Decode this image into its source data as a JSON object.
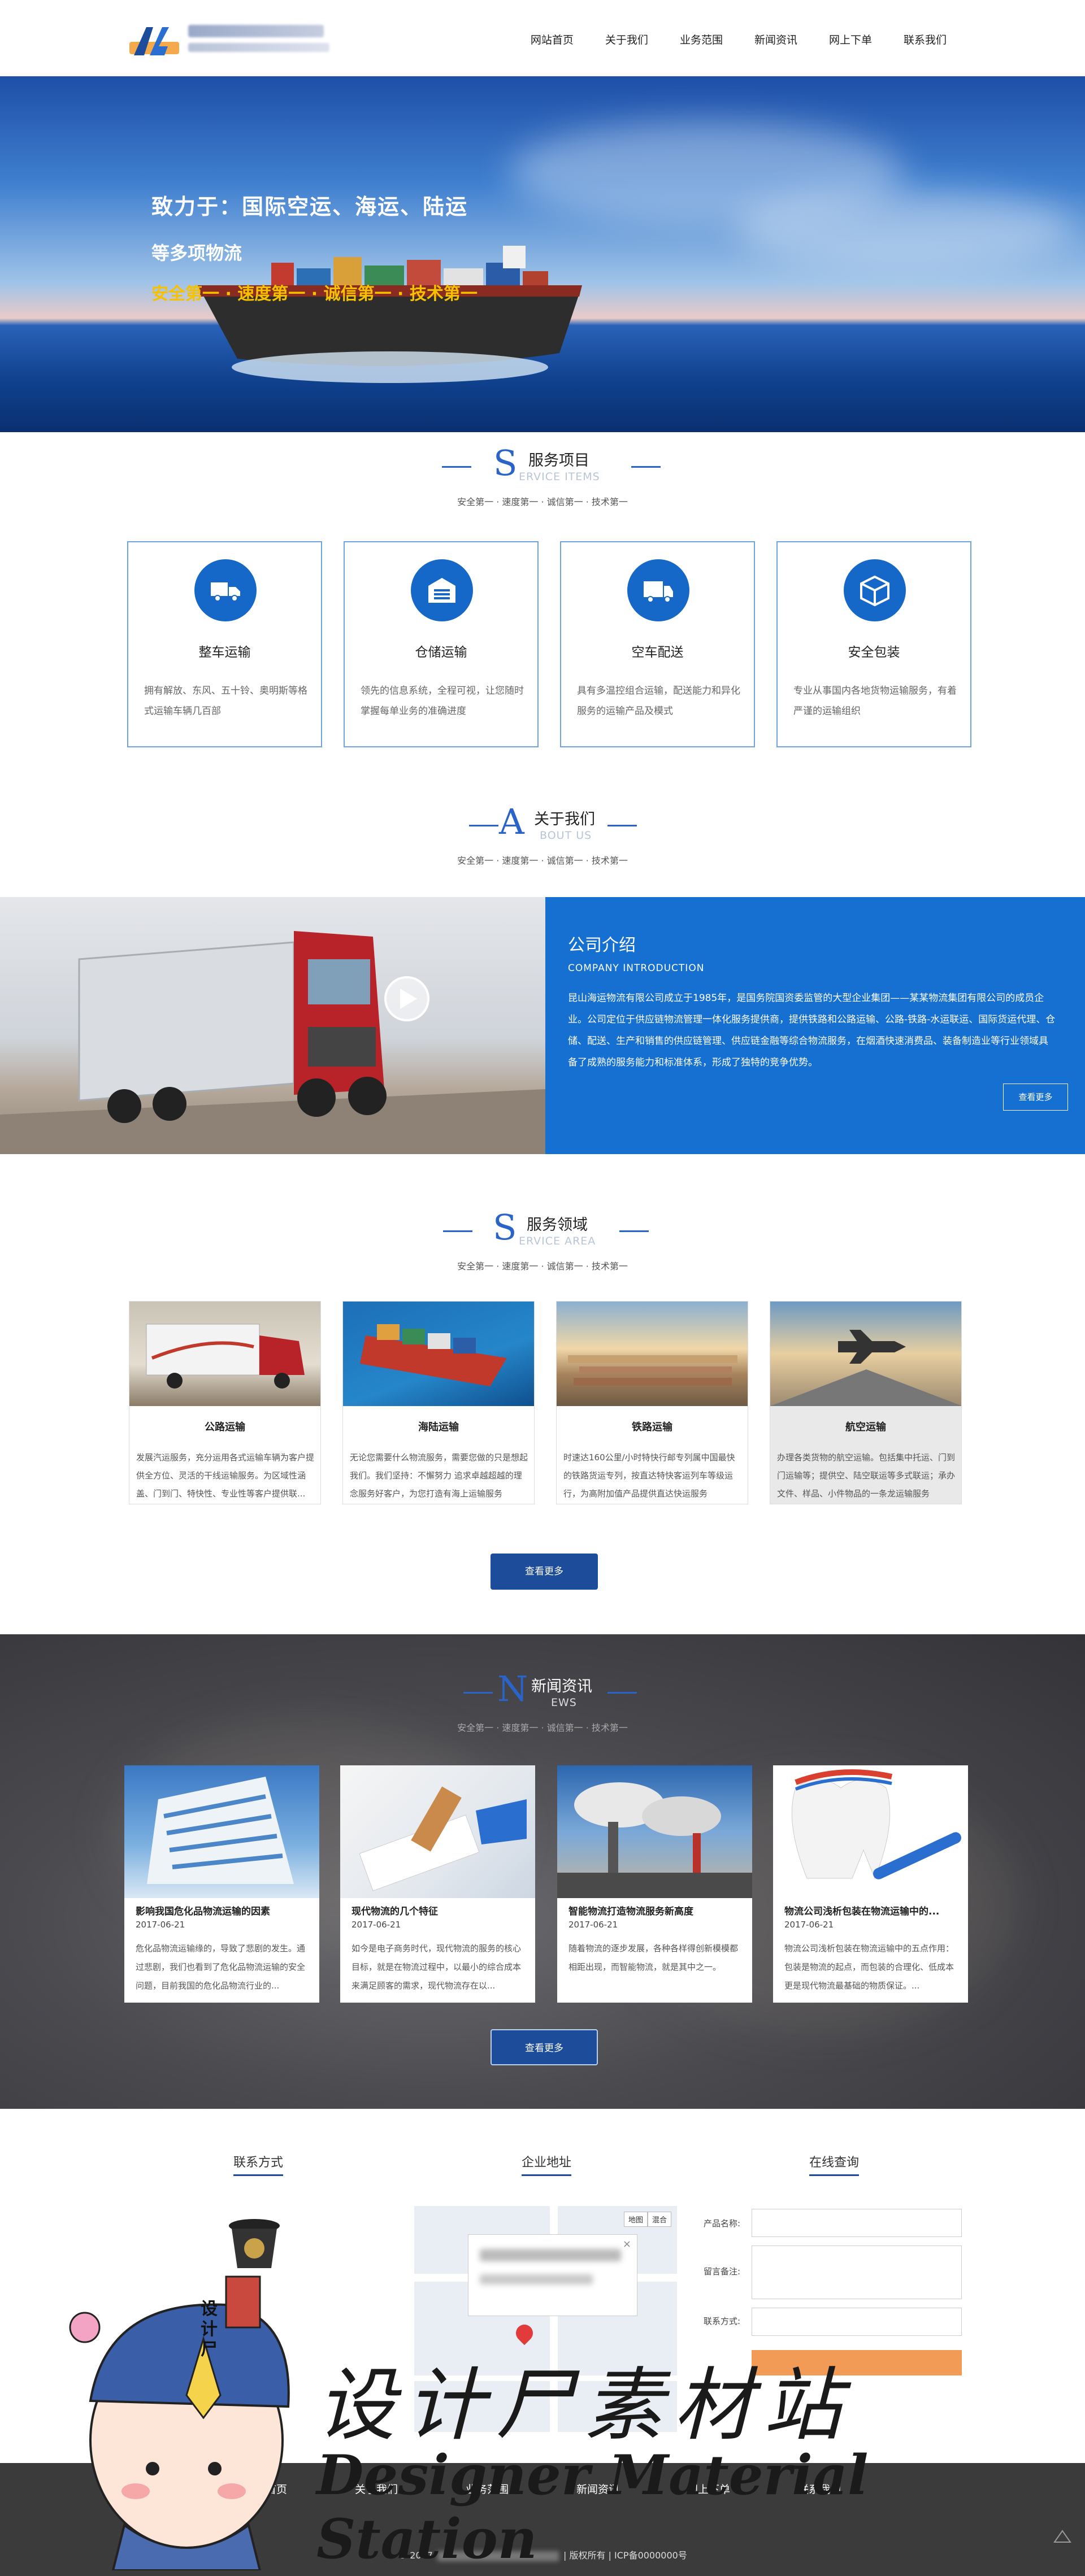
{
  "nav": [
    "网站首页",
    "关于我们",
    "业务范围",
    "新闻资讯",
    "网上下单",
    "联系我们"
  ],
  "hero": {
    "line1": "致力于：国际空运、海运、陆运",
    "line2": "等多项物流",
    "line3": "安全第一 · 速度第一 · 诚信第一 · 技术第一"
  },
  "sections": {
    "service": {
      "big": "S",
      "cn": "服务项目",
      "en": "ERVICE ITEMS",
      "sub": "安全第一 · 速度第一 · 诚信第一 · 技术第一"
    },
    "about": {
      "big": "A",
      "cn": "关于我们",
      "en": "BOUT US",
      "sub": "安全第一 · 速度第一 · 诚信第一 · 技术第一"
    },
    "area": {
      "big": "S",
      "cn": "服务领域",
      "en": "ERVICE AREA",
      "sub": "安全第一 · 速度第一 · 诚信第一 · 技术第一"
    },
    "news": {
      "big": "N",
      "cn": "新闻资讯",
      "en": "EWS",
      "sub": "安全第一 · 速度第一 · 诚信第一 · 技术第一"
    }
  },
  "services": [
    {
      "title": "整车运输",
      "desc": "拥有解放、东风、五十铃、奥明斯等格式运输车辆几百部"
    },
    {
      "title": "仓储运输",
      "desc": "领先的信息系统，全程可视，让您随时掌握每单业务的准确进度"
    },
    {
      "title": "空车配送",
      "desc": "具有多温控组合运输，配送能力和异化服务的运输产品及模式"
    },
    {
      "title": "安全包装",
      "desc": "专业从事国内各地货物运输服务，有着严谨的运输组织"
    }
  ],
  "about": {
    "title": "公司介绍",
    "en": "COMPANY INTRODUCTION",
    "text": "昆山海运物流有限公司成立于1985年，是国务院国资委监管的大型企业集团——某某物流集团有限公司的成员企业。公司定位于供应链物流管理一体化服务提供商，提供铁路和公路运输、公路-铁路-水运联运、国际货运代理、仓储、配送、生产和销售的供应链管理、供应链金融等综合物流服务，在烟酒快速消费品、装备制造业等行业领域具备了成熟的服务能力和标准体系，形成了独特的竞争优势。",
    "more": "查看更多"
  },
  "areas": [
    {
      "title": "公路运输",
      "desc": "发展汽运服务，充分运用各式运输车辆为客户提供全方位、灵活的干线运输服务。为区域性涵盖、门到门、特快性、专业性等客户提供联..."
    },
    {
      "title": "海陆运输",
      "desc": "无论您需要什么物流服务，需要您做的只是想起我们。我们坚持：不懈努力 追求卓越超越的理念服务好客户，为您打造有海上运输服务"
    },
    {
      "title": "铁路运输",
      "desc": "时速达160公里/小时特快行邮专列属中国最快的铁路货运专列，按直达特快客运列车等级运行，为高附加值产品提供直达快运服务"
    },
    {
      "title": "航空运输",
      "desc": "办理各类货物的航空运输。包括集中托运、门到门运输等；提供空、陆空联运等多式联运；承办文件、样品、小件物品的一条龙运输服务"
    }
  ],
  "area_more": "查看更多",
  "news": [
    {
      "title": "影响我国危化品物流运输的因素",
      "date": "2017-06-21",
      "desc": "危化品物流运输缘的，导致了悲剧的发生。通过悲剧，我们也看到了危化品物流运输的安全问题，目前我国的危化品物流行业的..."
    },
    {
      "title": "现代物流的几个特征",
      "date": "2017-06-21",
      "desc": "如今是电子商务时代，现代物流的服务的核心目标，就是在物流过程中，以最小的综合成本来满足顾客的需求，现代物流存在以..."
    },
    {
      "title": "智能物流打造物流服务新高度",
      "date": "2017-06-21",
      "desc": "随着物流的逐步发展，各种各样得创新模模都相距出现，而智能物流，就是其中之一。"
    },
    {
      "title": "物流公司浅析包装在物流运输中的...",
      "date": "2017-06-21",
      "desc": "物流公司浅析包装在物流运输中的五点作用：包装是物流的起点，而包装的合理化、低成本更是现代物流最基础的物质保证。..."
    }
  ],
  "news_more": "查看更多",
  "contact": {
    "col1": "联系方式",
    "col2": "企业地址",
    "col3": "在线查询",
    "map_tab1": "地图",
    "map_tab2": "混合",
    "map_close": "×",
    "label_product": "产品名称:",
    "label_message": "留言备注:",
    "label_contact": "联系方式:"
  },
  "footer": {
    "nav": [
      "网站首页",
      "关于我们",
      "业务范围",
      "新闻资讯",
      "网上下单",
      "联系我们"
    ],
    "copy_prefix": "© 2017",
    "copy_suffix": "| 版权所有 | ICP备0000000号"
  },
  "watermark": {
    "cn": "设计尸素材站",
    "en": "Designer Material Station",
    "badge": "设计尸"
  },
  "colors": {
    "primary": "#1670d1",
    "dark_button": "#1d4c9a",
    "hero_accent": "#f6c200",
    "footer": "#3b3b3b"
  }
}
